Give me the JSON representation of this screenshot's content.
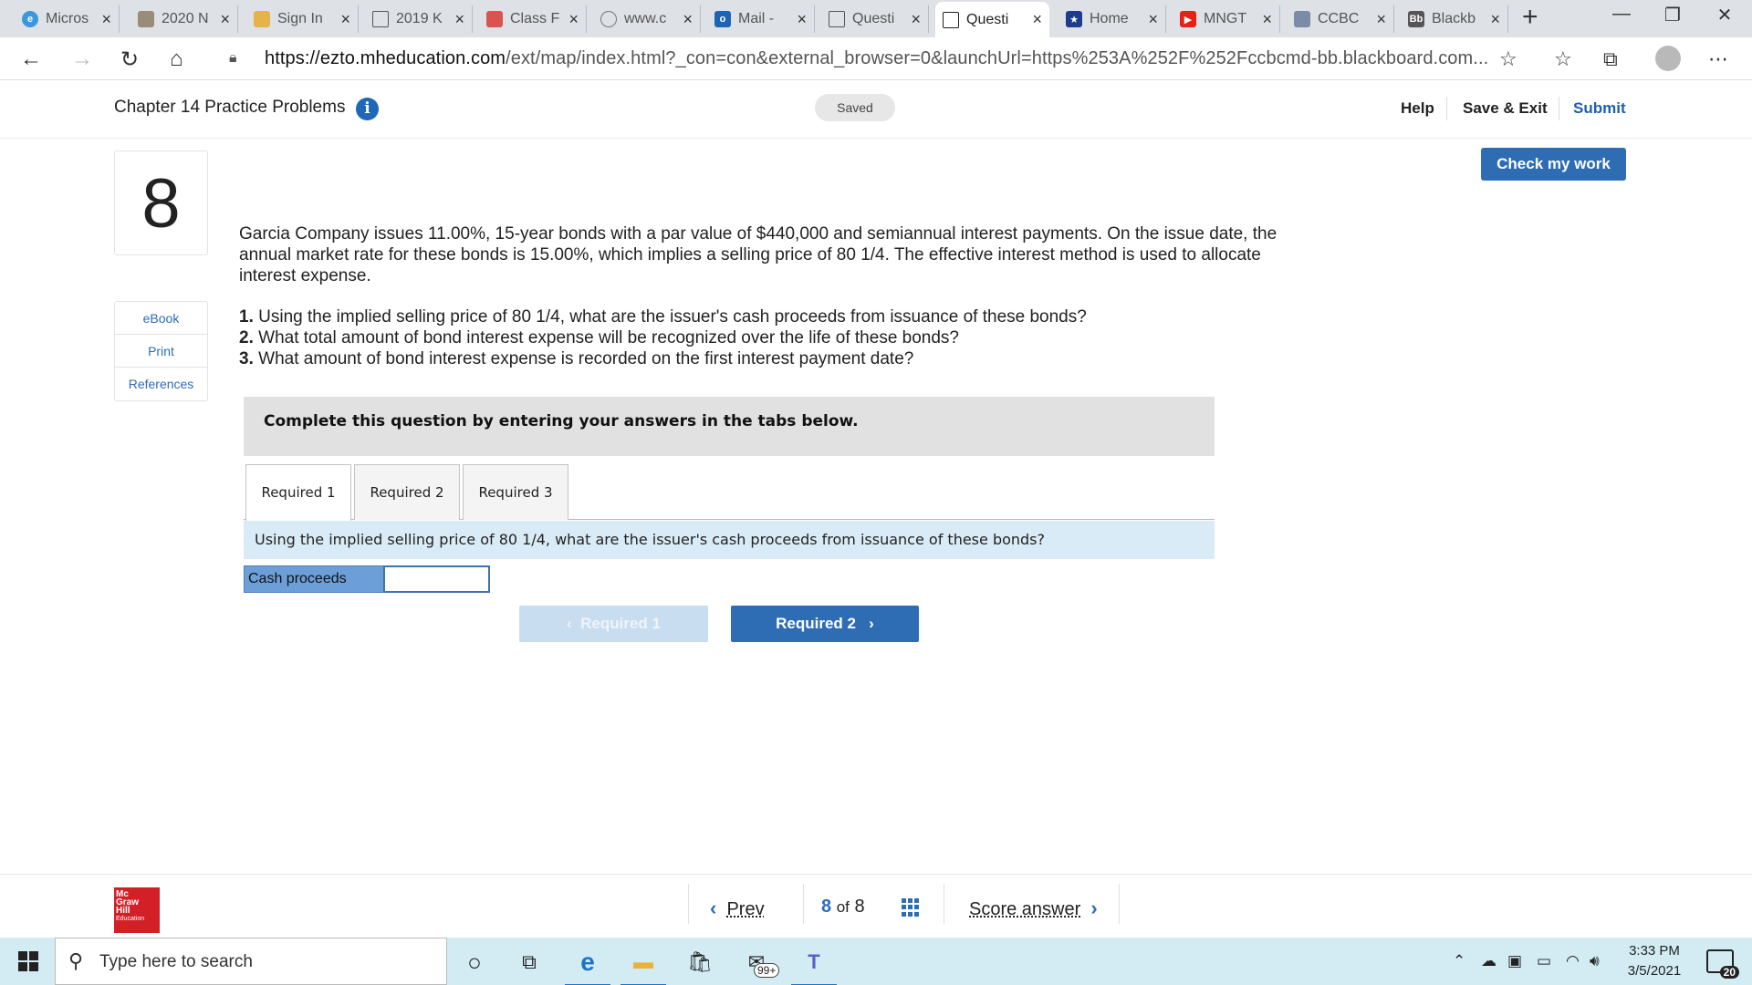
{
  "browser": {
    "tabs": [
      {
        "label": "Micros",
        "icon": "edge-icon",
        "color": "#3a96dd"
      },
      {
        "label": "2020 N",
        "icon": "image-icon",
        "color": "#9a8c7a"
      },
      {
        "label": "Sign In",
        "icon": "signin-icon",
        "color": "#e6b34a"
      },
      {
        "label": "2019 K",
        "icon": "page-icon",
        "color": "#ffffff"
      },
      {
        "label": "Class F",
        "icon": "class-icon",
        "color": "#d9534f"
      },
      {
        "label": "www.c",
        "icon": "pdf-icon",
        "color": "#8a8a8a"
      },
      {
        "label": "Mail -",
        "icon": "outlook-icon",
        "color": "#1e64b4"
      },
      {
        "label": "Questi",
        "icon": "page-icon",
        "color": "#ffffff"
      },
      {
        "label": "Questi",
        "icon": "page-icon",
        "color": "#ffffff"
      },
      {
        "label": "Home",
        "icon": "star-icon",
        "color": "#1c3c8c"
      },
      {
        "label": "MNGT",
        "icon": "youtube-icon",
        "color": "#e62117"
      },
      {
        "label": "CCBC",
        "icon": "ccbc-icon",
        "color": "#7a8ca8"
      },
      {
        "label": "Blackb",
        "icon": "blackboard-icon",
        "color": "#555555"
      }
    ],
    "tab_close": "×",
    "new_tab": "+",
    "url_host": "https://ezto.mheducation.com",
    "url_rest": "/ext/map/index.html?_con=con&external_browser=0&launchUrl=https%253A%252F%252Fccbcmd-bb.blackboard.com..."
  },
  "header": {
    "assignment_title": "Chapter 14 Practice Problems",
    "info_glyph": "i",
    "status": "Saved",
    "help": "Help",
    "save_exit": "Save & Exit",
    "submit": "Submit"
  },
  "question": {
    "number": "8",
    "check_my_work": "Check my work",
    "resources": [
      "eBook",
      "Print",
      "References"
    ],
    "stem": "Garcia Company issues 11.00%, 15-year bonds with a par value of $440,000 and semiannual interest payments. On the issue date, the annual market rate for these bonds is 15.00%, which implies a selling price of 80 1/4. The effective interest method is used to allocate interest expense.",
    "parts": [
      {
        "num": "1.",
        "text": "Using the implied selling price of 80 1/4, what are the issuer's cash proceeds from issuance of these bonds?"
      },
      {
        "num": "2.",
        "text": "What total amount of bond interest expense will be recognized over the life of these bonds?"
      },
      {
        "num": "3.",
        "text": "What amount of bond interest expense is recorded on the first interest payment date?"
      }
    ],
    "instructions": "Complete this question by entering your answers in the tabs below.",
    "tabs": [
      "Required 1",
      "Required 2",
      "Required 3"
    ],
    "active_tab": "Required 1",
    "prompt": "Using the implied selling price of 80 1/4, what are the issuer's cash proceeds from issuance of these bonds?",
    "answer_label": "Cash proceeds",
    "answer_value": "",
    "prev_button": "Required 1",
    "next_button": "Required 2"
  },
  "footer": {
    "logo_lines": [
      "Mc",
      "Graw",
      "Hill",
      "Education"
    ],
    "prev": "Prev",
    "current": "8",
    "of": "of",
    "total": "8",
    "score": "Score answer"
  },
  "taskbar": {
    "search_placeholder": "Type here to search",
    "mail_badge": "99+",
    "time": "3:33 PM",
    "date": "3/5/2021",
    "notifications": "20"
  },
  "colors": {
    "brand_blue": "#2e6db4",
    "prompt_bg": "#d9ebf7",
    "mh_red": "#d32027"
  }
}
